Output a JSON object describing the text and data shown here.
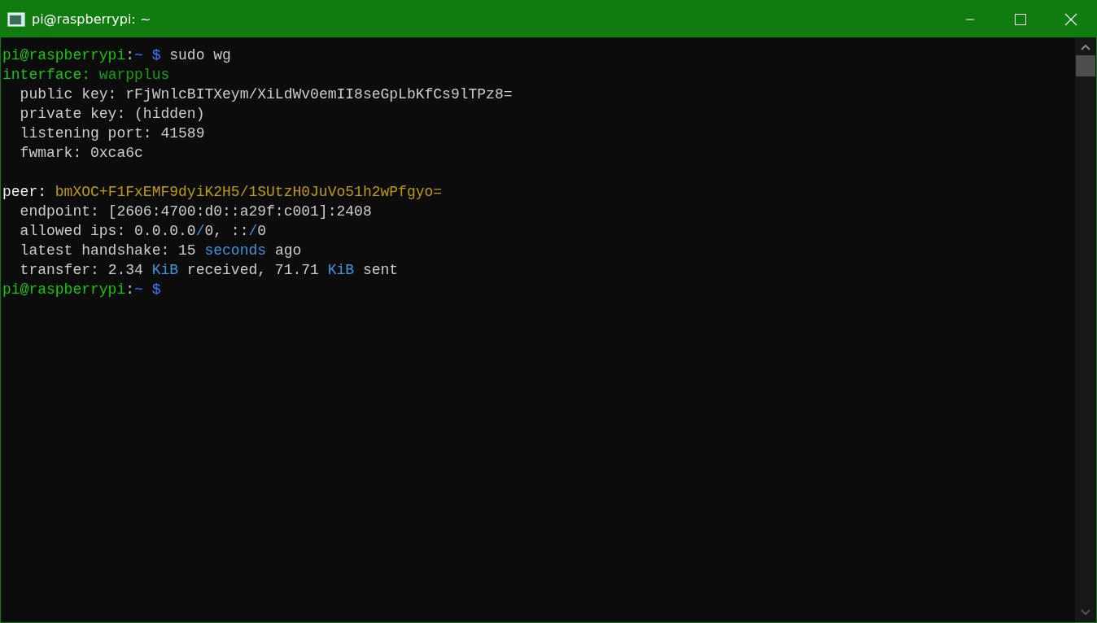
{
  "window": {
    "title": "pi@raspberrypi: ~"
  },
  "terminal": {
    "lines": [
      {
        "kind": "text",
        "segments": [
          {
            "text": "pi@raspberrypi",
            "color": "#16c60c"
          },
          {
            "text": ":",
            "color": "#cccccc"
          },
          {
            "text": "~ $",
            "color": "#3b78ff"
          },
          {
            "text": " sudo wg",
            "color": "#cccccc"
          }
        ]
      },
      {
        "kind": "text",
        "segments": [
          {
            "text": "interface:",
            "color": "#16c60c"
          },
          {
            "text": " warpplus",
            "color": "#13a10e"
          }
        ]
      },
      {
        "kind": "text",
        "segments": [
          {
            "text": "  public key:",
            "color": "#cccccc"
          },
          {
            "text": " rFjWnlcBITXeym/XiLdWv0emII8seGpLbKfCs9lTPz8=",
            "color": "#cccccc"
          }
        ]
      },
      {
        "kind": "text",
        "segments": [
          {
            "text": "  private key:",
            "color": "#cccccc"
          },
          {
            "text": " (hidden)",
            "color": "#cccccc"
          }
        ]
      },
      {
        "kind": "text",
        "segments": [
          {
            "text": "  listening port:",
            "color": "#cccccc"
          },
          {
            "text": " 41589",
            "color": "#cccccc"
          }
        ]
      },
      {
        "kind": "text",
        "segments": [
          {
            "text": "  fwmark:",
            "color": "#cccccc"
          },
          {
            "text": " 0xca6c",
            "color": "#cccccc"
          }
        ]
      },
      {
        "kind": "blank"
      },
      {
        "kind": "text",
        "segments": [
          {
            "text": "peer:",
            "color": "#f2f2f2"
          },
          {
            "text": " bmXOC+F1FxEMF9dyiK2H5/1SUtzH0JuVo51h2wPfgyo=",
            "color": "#c19c00"
          }
        ]
      },
      {
        "kind": "text",
        "segments": [
          {
            "text": "  endpoint:",
            "color": "#cccccc"
          },
          {
            "text": " [2606:4700:d0::a29f:c001]:2408",
            "color": "#cccccc"
          }
        ]
      },
      {
        "kind": "text",
        "segments": [
          {
            "text": "  allowed ips:",
            "color": "#cccccc"
          },
          {
            "text": " 0.0.0.0",
            "color": "#cccccc"
          },
          {
            "text": "/",
            "color": "#3a96dd"
          },
          {
            "text": "0, ::",
            "color": "#cccccc"
          },
          {
            "text": "/",
            "color": "#3a96dd"
          },
          {
            "text": "0",
            "color": "#cccccc"
          }
        ]
      },
      {
        "kind": "text",
        "segments": [
          {
            "text": "  latest handshake:",
            "color": "#cccccc"
          },
          {
            "text": " 15 ",
            "color": "#cccccc"
          },
          {
            "text": "seconds",
            "color": "#3a96dd"
          },
          {
            "text": " ago",
            "color": "#cccccc"
          }
        ]
      },
      {
        "kind": "text",
        "segments": [
          {
            "text": "  transfer:",
            "color": "#cccccc"
          },
          {
            "text": " 2.34 ",
            "color": "#cccccc"
          },
          {
            "text": "KiB",
            "color": "#3a96dd"
          },
          {
            "text": " received, 71.71 ",
            "color": "#cccccc"
          },
          {
            "text": "KiB",
            "color": "#3a96dd"
          },
          {
            "text": " sent",
            "color": "#cccccc"
          }
        ]
      },
      {
        "kind": "text",
        "segments": [
          {
            "text": "pi@raspberrypi",
            "color": "#16c60c"
          },
          {
            "text": ":",
            "color": "#cccccc"
          },
          {
            "text": "~ $",
            "color": "#3b78ff"
          }
        ]
      }
    ]
  }
}
